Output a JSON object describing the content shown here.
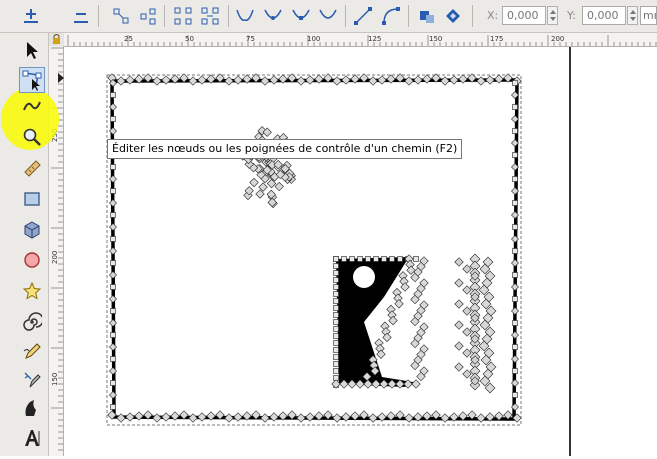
{
  "toolbar": {
    "x_label": "X:",
    "x_value": "0,000",
    "y_label": "Y:",
    "y_value": "0,000",
    "units_value": "mm"
  },
  "ruler": {
    "h_ticks": [
      "25",
      "50",
      "75",
      "100",
      "125",
      "150",
      "175",
      "200"
    ],
    "v_ticks": [
      "250",
      "200",
      "150"
    ]
  },
  "tools": [
    {
      "name": "select-tool",
      "icon": "arrow-cursor-icon"
    },
    {
      "name": "node-tool",
      "icon": "node-edit-icon",
      "active": true
    },
    {
      "name": "tweak-tool",
      "icon": "tweak-icon"
    },
    {
      "name": "zoom-tool",
      "icon": "magnifier-icon"
    },
    {
      "name": "measure-tool",
      "icon": "ruler-icon"
    },
    {
      "name": "rect-tool",
      "icon": "rectangle-icon"
    },
    {
      "name": "3dbox-tool",
      "icon": "cube-icon"
    },
    {
      "name": "ellipse-tool",
      "icon": "ellipse-icon"
    },
    {
      "name": "star-tool",
      "icon": "star-icon"
    },
    {
      "name": "spiral-tool",
      "icon": "spiral-icon"
    },
    {
      "name": "pencil-tool",
      "icon": "pencil-icon"
    },
    {
      "name": "pen-tool",
      "icon": "pen-icon"
    },
    {
      "name": "calligraphy-tool",
      "icon": "calligraphy-icon"
    },
    {
      "name": "text-tool",
      "icon": "text-icon"
    }
  ],
  "tooltip": {
    "text": "Éditer les nœuds ou les poignées de contrôle d'un chemin (F2)"
  },
  "colors": {
    "accent_highlight": "#f5f500",
    "toolbar_bg": "#eceae6",
    "node_blue": "#2a5db0"
  }
}
